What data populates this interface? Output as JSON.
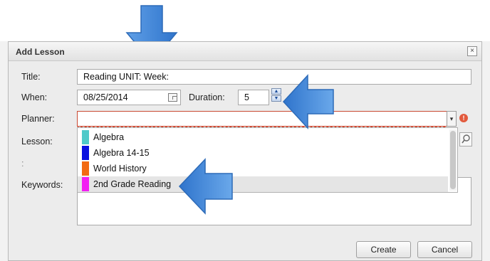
{
  "dialog": {
    "title": "Add Lesson",
    "close_symbol": "×"
  },
  "form": {
    "title_label": "Title:",
    "title_value": "Reading   UNIT:    Week:",
    "when_label": "When:",
    "when_value": "08/25/2014",
    "duration_label": "Duration:",
    "duration_value": "5",
    "planner_label": "Planner:",
    "planner_value": "",
    "lesson_label": "Lesson:",
    "extra_label": ":",
    "keywords_label": "Keywords:"
  },
  "planner_options": [
    {
      "label": "Algebra",
      "color": "#4fc9c9"
    },
    {
      "label": "Algebra 14-15",
      "color": "#0a10e0"
    },
    {
      "label": "World History",
      "color": "#f26a12"
    },
    {
      "label": "2nd Grade Reading",
      "color": "#f21ef2",
      "selected": true
    }
  ],
  "buttons": {
    "create": "Create",
    "cancel": "Cancel"
  },
  "icons": {
    "calendar": "calendar-icon",
    "spinner_up": "▲",
    "spinner_down": "▼",
    "dropdown": "▾",
    "error": "!",
    "search": "search-icon"
  },
  "colors": {
    "error": "#d04a33",
    "arrow": "#3f86d8"
  }
}
